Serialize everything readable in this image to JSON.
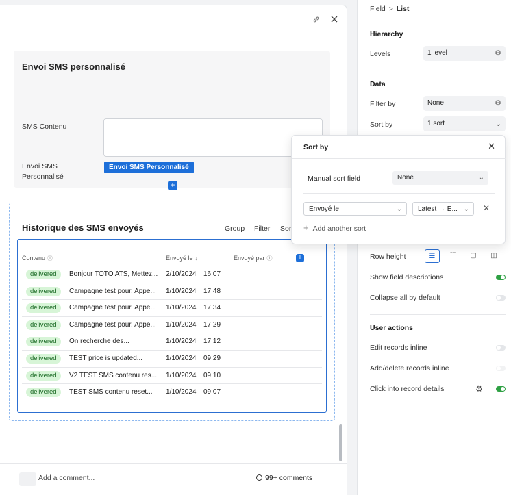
{
  "form": {
    "card_title": "Envoi SMS personnalisé",
    "sms_content_label": "SMS Contenu",
    "envoi_label_line1": "Envoi SMS",
    "envoi_label_line2": "Personnalisé",
    "envoi_button": "Envoi SMS Personnalisé"
  },
  "history": {
    "title": "Historique des SMS envoyés",
    "actions": {
      "group": "Group",
      "filter": "Filter",
      "sort": "Sort"
    },
    "columns": {
      "content": "Contenu",
      "sent_on": "Envoyé le",
      "sent_by": "Envoyé par"
    },
    "rows": [
      {
        "status": "delivered",
        "content": "Bonjour TOTO ATS, Mettez...",
        "date": "2/10/2024",
        "time": "16:07"
      },
      {
        "status": "delivered",
        "content": "Campagne test pour. Appe...",
        "date": "1/10/2024",
        "time": "17:48"
      },
      {
        "status": "delivered",
        "content": "Campagne test pour. Appe...",
        "date": "1/10/2024",
        "time": "17:34"
      },
      {
        "status": "delivered",
        "content": "Campagne test pour. Appe...",
        "date": "1/10/2024",
        "time": "17:29"
      },
      {
        "status": "delivered",
        "content": "On recherche des...",
        "date": "1/10/2024",
        "time": "17:12"
      },
      {
        "status": "delivered",
        "content": "TEST price is updated...",
        "date": "1/10/2024",
        "time": "09:29"
      },
      {
        "status": "delivered",
        "content": "V2 TEST SMS contenu res...",
        "date": "1/10/2024",
        "time": "09:10"
      },
      {
        "status": "delivered",
        "content": "TEST SMS contenu reset...",
        "date": "1/10/2024",
        "time": "09:07"
      }
    ]
  },
  "comments": {
    "placeholder": "Add a comment...",
    "count": "99+ comments"
  },
  "panel": {
    "breadcrumb_parent": "Field",
    "breadcrumb_sep": ">",
    "breadcrumb_current": "List",
    "hierarchy_title": "Hierarchy",
    "levels_label": "Levels",
    "levels_value": "1 level",
    "data_title": "Data",
    "filter_label": "Filter by",
    "filter_value": "None",
    "sort_label": "Sort by",
    "sort_value": "1 sort",
    "row_height_label": "Row height",
    "show_desc_label": "Show field descriptions",
    "collapse_label": "Collapse all by default",
    "user_actions_title": "User actions",
    "edit_inline_label": "Edit records inline",
    "add_delete_label": "Add/delete records inline",
    "click_into_label": "Click into record details"
  },
  "sort_popover": {
    "title": "Sort by",
    "manual_label": "Manual sort field",
    "manual_value": "None",
    "field_value": "Envoyé le",
    "direction_value": "Latest → E...",
    "add_sort": "Add another sort"
  },
  "colors": {
    "accent": "#1d6fd9",
    "badge_bg": "#d7f5d7",
    "toggle_on": "#2ea043"
  }
}
